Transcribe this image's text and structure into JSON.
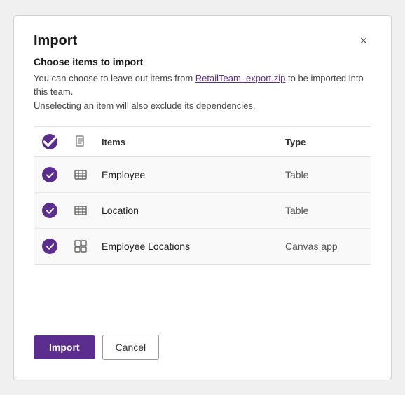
{
  "dialog": {
    "title": "Import",
    "close_label": "×",
    "subtitle": "Choose items to import",
    "description_part1": "You can choose to leave out items from ",
    "description_link": "RetailTeam_export.zip",
    "description_part2": " to be imported into this team.",
    "description_line2": "Unselecting an item will also exclude its dependencies."
  },
  "table": {
    "columns": {
      "check": "",
      "icon": "",
      "items": "Items",
      "type": "Type"
    },
    "rows": [
      {
        "id": 1,
        "name": "Employee",
        "type": "Table",
        "checked": true,
        "icon": "table"
      },
      {
        "id": 2,
        "name": "Location",
        "type": "Table",
        "checked": true,
        "icon": "table"
      },
      {
        "id": 3,
        "name": "Employee Locations",
        "type": "Canvas app",
        "checked": true,
        "icon": "canvas"
      }
    ]
  },
  "footer": {
    "import_label": "Import",
    "cancel_label": "Cancel"
  }
}
